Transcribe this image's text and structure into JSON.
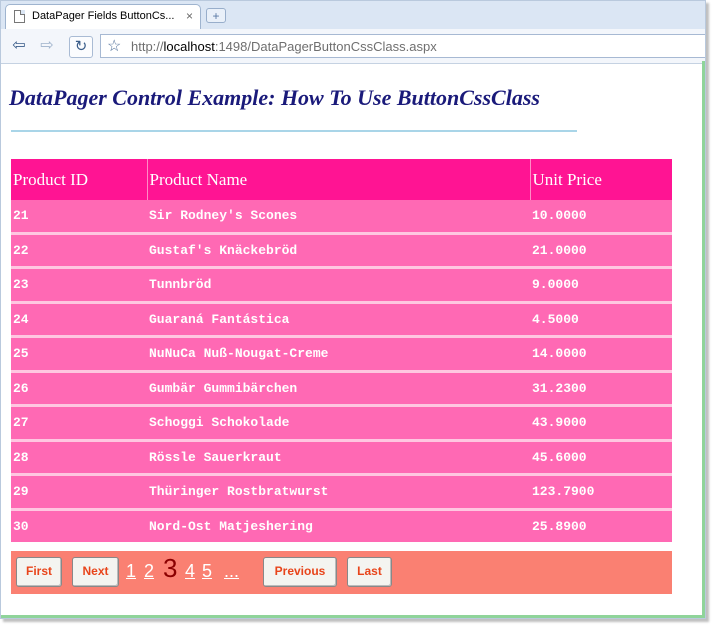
{
  "browser": {
    "tab_title": "DataPager Fields ButtonCs...",
    "tab_close": "×",
    "new_tab": "+",
    "url_prefix": "http://",
    "url_host": "localhost",
    "url_rest": ":1498/DataPagerButtonCssClass.aspx",
    "back_glyph": "⇦",
    "forward_glyph": "⇨",
    "reload_glyph": "↻",
    "star_glyph": "☆"
  },
  "page": {
    "title": "DataPager Control Example: How To Use ButtonCssClass"
  },
  "grid": {
    "columns": [
      "Product ID",
      "Product Name",
      "Unit Price"
    ],
    "rows": [
      [
        "21",
        "Sir Rodney's Scones",
        "10.0000"
      ],
      [
        "22",
        "Gustaf's Knäckebröd",
        "21.0000"
      ],
      [
        "23",
        "Tunnbröd",
        "9.0000"
      ],
      [
        "24",
        "Guaraná Fantástica",
        "4.5000"
      ],
      [
        "25",
        "NuNuCa Nuß-Nougat-Creme",
        "14.0000"
      ],
      [
        "26",
        "Gumbär Gummibärchen",
        "31.2300"
      ],
      [
        "27",
        "Schoggi Schokolade",
        "43.9000"
      ],
      [
        "28",
        "Rössle Sauerkraut",
        "45.6000"
      ],
      [
        "29",
        "Thüringer Rostbratwurst",
        "123.7900"
      ],
      [
        "30",
        "Nord-Ost Matjeshering",
        "25.8900"
      ]
    ]
  },
  "pager": {
    "first": "First",
    "next": "Next",
    "pages": [
      "1",
      "2",
      "3",
      "4",
      "5"
    ],
    "current_page": "3",
    "ellipsis": "...",
    "previous": "Previous",
    "last": "Last"
  },
  "colors": {
    "header_bg": "#ff1493",
    "row_bg": "#ff69b4",
    "pager_bg": "#fa8072",
    "title_color": "#1a1a7a",
    "current_page_color": "#8b0000"
  }
}
